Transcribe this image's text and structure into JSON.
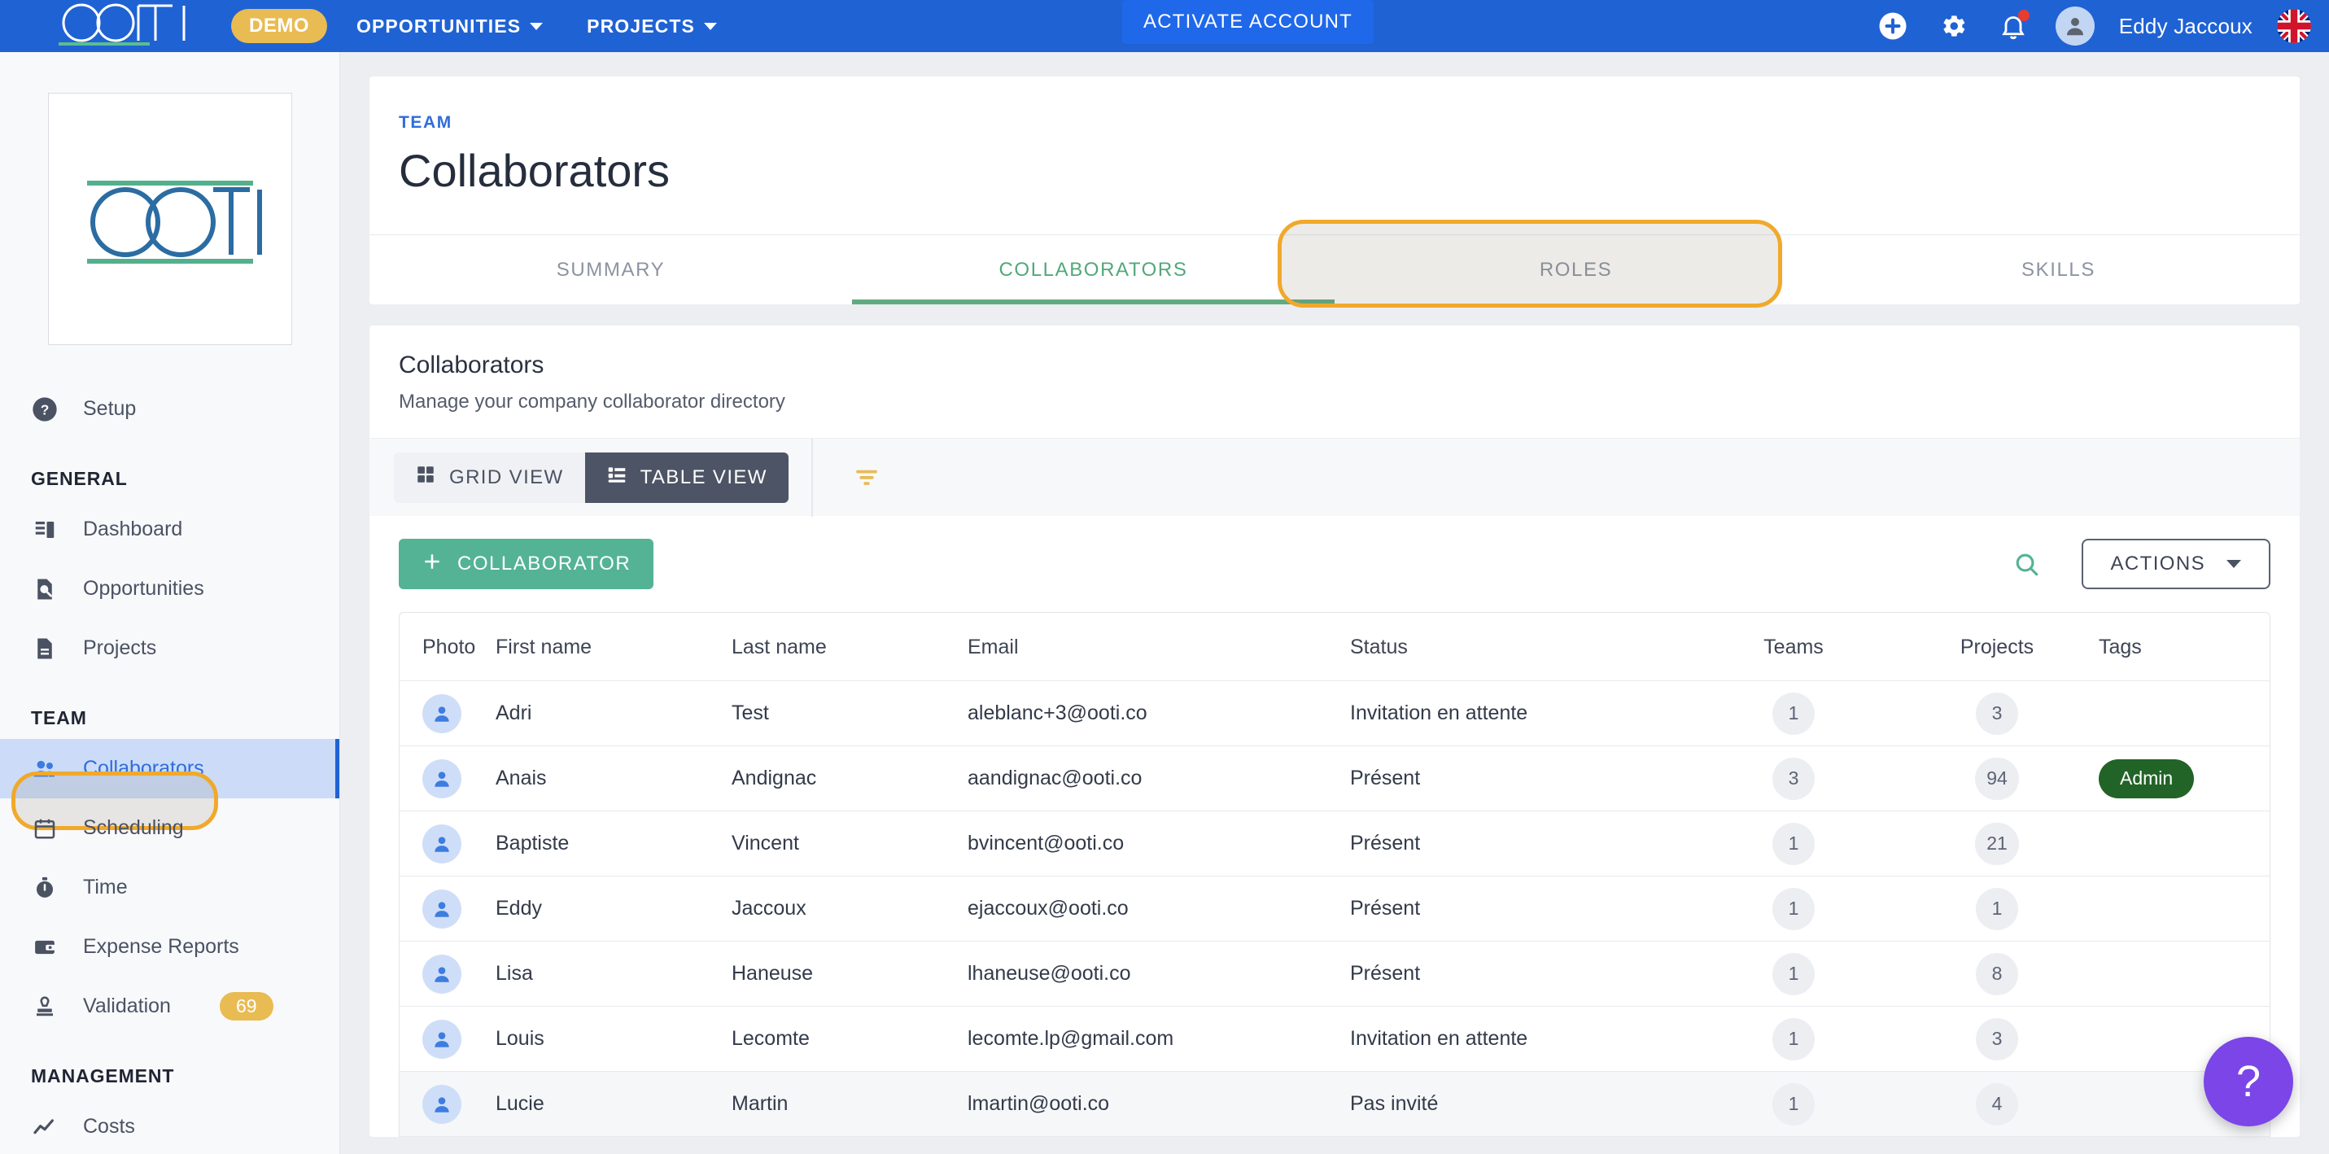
{
  "topbar": {
    "logo_alt": "OOTI",
    "demo_badge": "DEMO",
    "nav": [
      {
        "label": "OPPORTUNITIES",
        "has_caret": true
      },
      {
        "label": "PROJECTS",
        "has_caret": true
      }
    ],
    "activate_button": "ACTIVATE ACCOUNT",
    "user_name": "Eddy Jaccoux",
    "icons": [
      "add-circle-icon",
      "gear-icon",
      "bell-icon",
      "avatar",
      "flag-uk-icon"
    ]
  },
  "sidebar": {
    "setup": {
      "label": "Setup",
      "icon": "help-circle-icon"
    },
    "sections": [
      {
        "title": "GENERAL",
        "items": [
          {
            "label": "Dashboard",
            "icon": "dashboard-icon"
          },
          {
            "label": "Opportunities",
            "icon": "opportunity-search-icon"
          },
          {
            "label": "Projects",
            "icon": "document-icon"
          }
        ]
      },
      {
        "title": "TEAM",
        "items": [
          {
            "label": "Collaborators",
            "icon": "people-icon",
            "active": true
          },
          {
            "label": "Scheduling",
            "icon": "calendar-icon"
          },
          {
            "label": "Time",
            "icon": "stopwatch-icon"
          },
          {
            "label": "Expense Reports",
            "icon": "wallet-icon"
          },
          {
            "label": "Validation",
            "icon": "stamp-icon",
            "badge": "69"
          }
        ]
      },
      {
        "title": "MANAGEMENT",
        "items": [
          {
            "label": "Costs",
            "icon": "trend-line-icon"
          }
        ]
      }
    ]
  },
  "page": {
    "breadcrumb": "TEAM",
    "title": "Collaborators",
    "tabs": [
      {
        "label": "SUMMARY",
        "active": false
      },
      {
        "label": "COLLABORATORS",
        "active": true
      },
      {
        "label": "ROLES",
        "active": false
      },
      {
        "label": "SKILLS",
        "active": false
      }
    ]
  },
  "panel": {
    "title": "Collaborators",
    "subtitle": "Manage your company collaborator directory",
    "view_toggle": [
      {
        "label": "GRID VIEW",
        "icon": "grid-icon",
        "selected": false
      },
      {
        "label": "TABLE VIEW",
        "icon": "list-icon",
        "selected": true
      }
    ],
    "filter_icon": "filter-icon",
    "add_button": "COLLABORATOR",
    "search_icon": "search-icon",
    "actions_button": "ACTIONS"
  },
  "table": {
    "columns": [
      "Photo",
      "First name",
      "Last name",
      "Email",
      "Status",
      "Teams",
      "Projects",
      "Tags",
      ""
    ],
    "rows": [
      {
        "first": "Adri",
        "last": "Test",
        "email": "aleblanc+3@ooti.co",
        "status": "Invitation en attente",
        "teams": "1",
        "projects": "3",
        "tag": ""
      },
      {
        "first": "Anais",
        "last": "Andignac",
        "email": "aandignac@ooti.co",
        "status": "Présent",
        "teams": "3",
        "projects": "94",
        "tag": "Admin"
      },
      {
        "first": "Baptiste",
        "last": "Vincent",
        "email": "bvincent@ooti.co",
        "status": "Présent",
        "teams": "1",
        "projects": "21",
        "tag": ""
      },
      {
        "first": "Eddy",
        "last": "Jaccoux",
        "email": "ejaccoux@ooti.co",
        "status": "Présent",
        "teams": "1",
        "projects": "1",
        "tag": ""
      },
      {
        "first": "Lisa",
        "last": "Haneuse",
        "email": "lhaneuse@ooti.co",
        "status": "Présent",
        "teams": "1",
        "projects": "8",
        "tag": ""
      },
      {
        "first": "Louis",
        "last": "Lecomte",
        "email": "lecomte.lp@gmail.com",
        "status": "Invitation en attente",
        "teams": "1",
        "projects": "3",
        "tag": ""
      },
      {
        "first": "Lucie",
        "last": "Martin",
        "email": "lmartin@ooti.co",
        "status": "Pas invité",
        "teams": "1",
        "projects": "4",
        "tag": ""
      }
    ]
  },
  "help_fab": {
    "label": "?",
    "icon": "question-mark-icon"
  },
  "colors": {
    "brand_blue": "#1f62d4",
    "accent_amber": "#e8bb53",
    "accent_green": "#54b394",
    "tab_green": "#62ab80",
    "highlight_outline": "#f0a92c",
    "admin_tag": "#226327",
    "help_purple": "#7b45e8"
  }
}
